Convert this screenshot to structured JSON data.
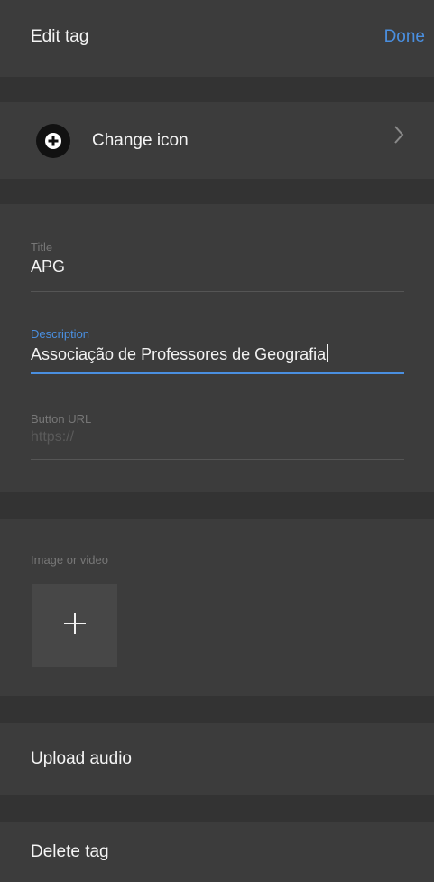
{
  "header": {
    "title": "Edit tag",
    "done_label": "Done"
  },
  "change_icon": {
    "label": "Change icon"
  },
  "form": {
    "title": {
      "label": "Title",
      "value": "APG"
    },
    "description": {
      "label": "Description",
      "value": "Associação de Professores de Geografia"
    },
    "button_url": {
      "label": "Button URL",
      "placeholder": "https://"
    }
  },
  "media": {
    "label": "Image or video"
  },
  "upload_audio": {
    "label": "Upload audio"
  },
  "delete_tag": {
    "label": "Delete tag"
  },
  "colors": {
    "accent": "#4a8fe0",
    "background": "#3c3c3c",
    "separator": "#333333"
  }
}
